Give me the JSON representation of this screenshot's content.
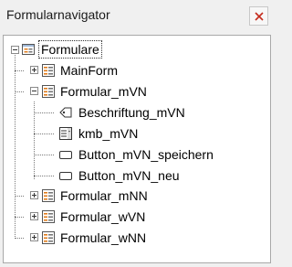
{
  "window": {
    "title": "Formularnavigator",
    "close_icon": "close-icon",
    "close_color": "#c42b1c"
  },
  "tree": {
    "root": {
      "label": "Formulare",
      "icon": "forms-icon",
      "expanded": true
    },
    "forms": [
      {
        "label": "MainForm",
        "icon": "form-icon",
        "expanded": false
      },
      {
        "label": "Formular_mVN",
        "icon": "form-icon",
        "expanded": true,
        "children": [
          {
            "label": "Beschriftung_mVN",
            "icon": "label-field-icon"
          },
          {
            "label": "kmb_mVN",
            "icon": "combobox-icon"
          },
          {
            "label": "Button_mVN_speichern",
            "icon": "push-button-icon"
          },
          {
            "label": "Button_mVN_neu",
            "icon": "push-button-icon"
          }
        ]
      },
      {
        "label": "Formular_mNN",
        "icon": "form-icon",
        "expanded": false
      },
      {
        "label": "Formular_wVN",
        "icon": "form-icon",
        "expanded": false
      },
      {
        "label": "Formular_wNN",
        "icon": "form-icon",
        "expanded": false
      }
    ]
  }
}
